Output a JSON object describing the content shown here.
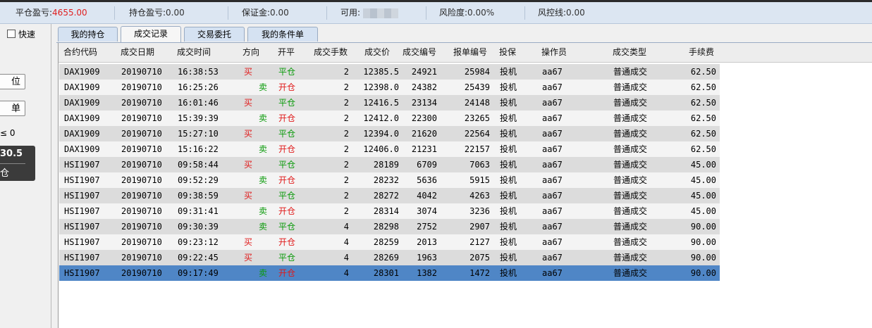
{
  "status": {
    "close_pnl_label": "平仓盈亏:",
    "close_pnl_value": "4655.00",
    "hold_pnl_label": "持仓盈亏:",
    "hold_pnl_value": "0.00",
    "margin_label": "保证金:",
    "margin_value": "0.00",
    "available_label": "可用:",
    "risk_label": "风险度:",
    "risk_value": "0.00%",
    "control_label": "风控线:",
    "control_value": "0.00"
  },
  "left": {
    "quick_label": "快速",
    "btn1": "位",
    "btn2": "单",
    "num_text": "≤ 0",
    "price": "30.5",
    "pos": "仓"
  },
  "tabs": [
    "我的持仓",
    "成交记录",
    "交易委托",
    "我的条件单"
  ],
  "active_tab": 1,
  "table": {
    "headers": [
      "合约代码",
      "成交日期",
      "成交时间",
      "方向",
      "开平",
      "成交手数",
      "成交价",
      "成交编号",
      "报单编号",
      "投保",
      "操作员",
      "成交类型",
      "手续费"
    ],
    "rows": [
      [
        "DAX1909",
        "20190710",
        "16:38:53",
        "买",
        "平仓",
        "2",
        "12385.5",
        "24921",
        "25984",
        "投机",
        "aa67",
        "普通成交",
        "62.50"
      ],
      [
        "DAX1909",
        "20190710",
        "16:25:26",
        "卖",
        "开仓",
        "2",
        "12398.0",
        "24382",
        "25439",
        "投机",
        "aa67",
        "普通成交",
        "62.50"
      ],
      [
        "DAX1909",
        "20190710",
        "16:01:46",
        "买",
        "平仓",
        "2",
        "12416.5",
        "23134",
        "24148",
        "投机",
        "aa67",
        "普通成交",
        "62.50"
      ],
      [
        "DAX1909",
        "20190710",
        "15:39:39",
        "卖",
        "开仓",
        "2",
        "12412.0",
        "22300",
        "23265",
        "投机",
        "aa67",
        "普通成交",
        "62.50"
      ],
      [
        "DAX1909",
        "20190710",
        "15:27:10",
        "买",
        "平仓",
        "2",
        "12394.0",
        "21620",
        "22564",
        "投机",
        "aa67",
        "普通成交",
        "62.50"
      ],
      [
        "DAX1909",
        "20190710",
        "15:16:22",
        "卖",
        "开仓",
        "2",
        "12406.0",
        "21231",
        "22157",
        "投机",
        "aa67",
        "普通成交",
        "62.50"
      ],
      [
        "HSI1907",
        "20190710",
        "09:58:44",
        "买",
        "平仓",
        "2",
        "28189",
        "6709",
        "7063",
        "投机",
        "aa67",
        "普通成交",
        "45.00"
      ],
      [
        "HSI1907",
        "20190710",
        "09:52:29",
        "卖",
        "开仓",
        "2",
        "28232",
        "5636",
        "5915",
        "投机",
        "aa67",
        "普通成交",
        "45.00"
      ],
      [
        "HSI1907",
        "20190710",
        "09:38:59",
        "买",
        "平仓",
        "2",
        "28272",
        "4042",
        "4263",
        "投机",
        "aa67",
        "普通成交",
        "45.00"
      ],
      [
        "HSI1907",
        "20190710",
        "09:31:41",
        "卖",
        "开仓",
        "2",
        "28314",
        "3074",
        "3236",
        "投机",
        "aa67",
        "普通成交",
        "45.00"
      ],
      [
        "HSI1907",
        "20190710",
        "09:30:39",
        "卖",
        "平仓",
        "4",
        "28298",
        "2752",
        "2907",
        "投机",
        "aa67",
        "普通成交",
        "90.00"
      ],
      [
        "HSI1907",
        "20190710",
        "09:23:12",
        "买",
        "开仓",
        "4",
        "28259",
        "2013",
        "2127",
        "投机",
        "aa67",
        "普通成交",
        "90.00"
      ],
      [
        "HSI1907",
        "20190710",
        "09:22:45",
        "买",
        "平仓",
        "4",
        "28269",
        "1963",
        "2075",
        "投机",
        "aa67",
        "普通成交",
        "90.00"
      ],
      [
        "HSI1907",
        "20190710",
        "09:17:49",
        "卖",
        "开仓",
        "4",
        "28301",
        "1382",
        "1472",
        "投机",
        "aa67",
        "普通成交",
        "90.00"
      ]
    ],
    "selected_row": 13
  },
  "colors": {
    "buy": "#e01a1a",
    "sell": "#0a9a0a",
    "selected": "#4f86c6",
    "profit": "#e02020"
  }
}
